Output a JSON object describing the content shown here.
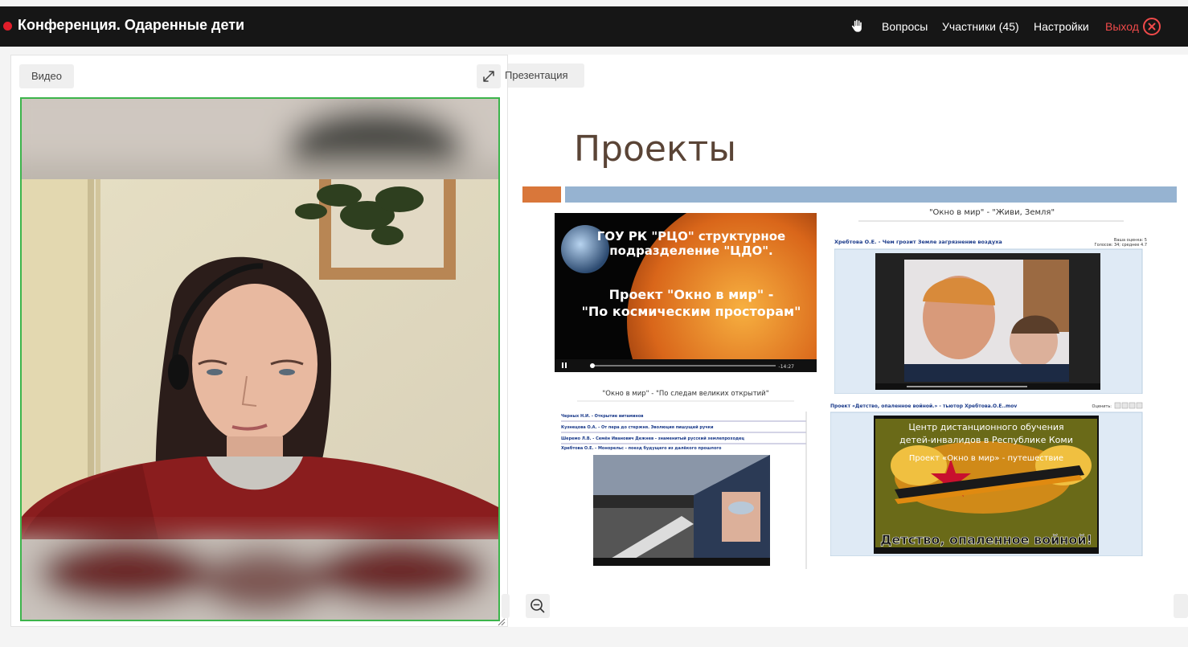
{
  "header": {
    "title": "Конференция. Одаренные дети",
    "nav": {
      "questions": "Вопросы",
      "participants": "Участники (45)",
      "settings": "Настройки",
      "exit": "Выход"
    }
  },
  "video_panel": {
    "tab_label": "Видео"
  },
  "presentation_panel": {
    "tab_label": "Презентация",
    "slide": {
      "title": "Проекты",
      "thumb1": {
        "line1": "ГОУ РК \"РЦО\" структурное",
        "line2": "подразделение \"ЦДО\".",
        "line3": "Проект \"Окно в мир\" -",
        "line4": "\"По космическим просторам\"",
        "time": "-14:27"
      },
      "thumb2": {
        "heading": "\"Окно в мир\" - \"Живи, Земля\"",
        "caption": "Хребтова О.Е. - Чем грозит Земле загрязнение воздуха",
        "rating": "Ваша оценка: 5",
        "votes": "Голосов: 34; среднее 4.7"
      },
      "thumb3": {
        "heading": "\"Окно в мир\" - \"По следам великих открытий\"",
        "rows": [
          "Черных Н.И. - Открытие витаминов",
          "Кузнецова О.А. - От пера до стержня. Эволюция пишущей ручки",
          "Шеремо Л.В. - Семён Иванович Дежнев - знаменитый русский землепроходец",
          "Хребтова О.Е. - Монорельс - поезд будущего из далёкого прошлого"
        ]
      },
      "thumb4": {
        "caption": "Проект «Детство, опаленное войной.» - тьютор Хребтова.О.Е..mov",
        "rate_label": "Оценить:",
        "line1": "Центр дистанционного обучения",
        "line2": "детей-инвалидов в Республике Коми",
        "line3": "Проект «Окно в мир» - путешествие",
        "line4": "...",
        "banner": "Детство, опаленное войной!"
      }
    }
  },
  "colors": {
    "topbar": "#161616",
    "exit": "#f04a4a",
    "active_speaker": "#3cb44b",
    "accent_orange": "#d9773a",
    "accent_blue": "#96b3d1"
  },
  "icons": {
    "hand": "raise-hand-icon",
    "exit": "close-circle-icon",
    "expand": "expand-icon",
    "zoom_out": "zoom-out-icon"
  }
}
